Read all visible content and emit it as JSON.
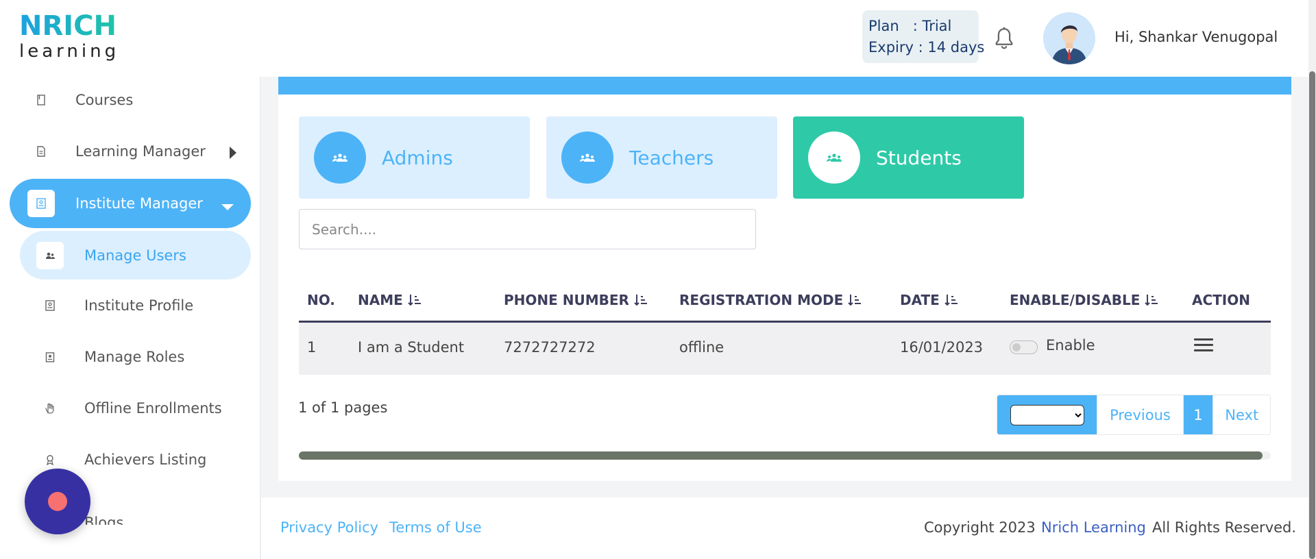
{
  "header": {
    "logo_top": "NRICH",
    "logo_bottom": "learning",
    "plan_line": "Plan   : Trial",
    "expiry_line": "Expiry : 14 days",
    "greeting": "Hi, Shankar Venugopal"
  },
  "sidebar": {
    "items": [
      {
        "label": "Courses",
        "icon": "book-icon"
      },
      {
        "label": "Learning Manager",
        "icon": "document-icon"
      },
      {
        "label": "Institute Manager",
        "icon": "id-card-icon"
      },
      {
        "label": "Manage Users",
        "icon": "users-icon"
      },
      {
        "label": "Institute Profile",
        "icon": "profile-icon"
      },
      {
        "label": "Manage Roles",
        "icon": "badge-icon"
      },
      {
        "label": "Offline Enrollments",
        "icon": "hand-icon"
      },
      {
        "label": "Achievers Listing",
        "icon": "award-icon"
      },
      {
        "label": "Blogs",
        "icon": "blog-icon"
      }
    ]
  },
  "roles": {
    "admins": "Admins",
    "teachers": "Teachers",
    "students": "Students"
  },
  "search": {
    "placeholder": "Search...."
  },
  "table": {
    "headers": [
      "NO.",
      "NAME",
      "PHONE NUMBER",
      "REGISTRATION MODE",
      "DATE",
      "ENABLE/DISABLE",
      "ACTION"
    ],
    "rows": [
      {
        "no": "1",
        "name": "I am a Student",
        "phone": "7272727272",
        "mode": "offline",
        "date": "16/01/2023",
        "status": "Enable",
        "enabled": false
      }
    ]
  },
  "pagination": {
    "summary": "1 of 1 pages",
    "previous": "Previous",
    "current": "1",
    "next": "Next"
  },
  "footer": {
    "privacy": "Privacy Policy",
    "terms": "Terms of Use",
    "copyright_prefix": "Copyright 2023",
    "company": "Nrich Learning",
    "copyright_suffix": "All Rights Reserved."
  },
  "colors": {
    "accent": "#4db3f7",
    "accent_light": "#dcefff",
    "students_green": "#2ecaa7",
    "header_navy": "#3d3d5c",
    "chat_purple": "#3730a3"
  }
}
